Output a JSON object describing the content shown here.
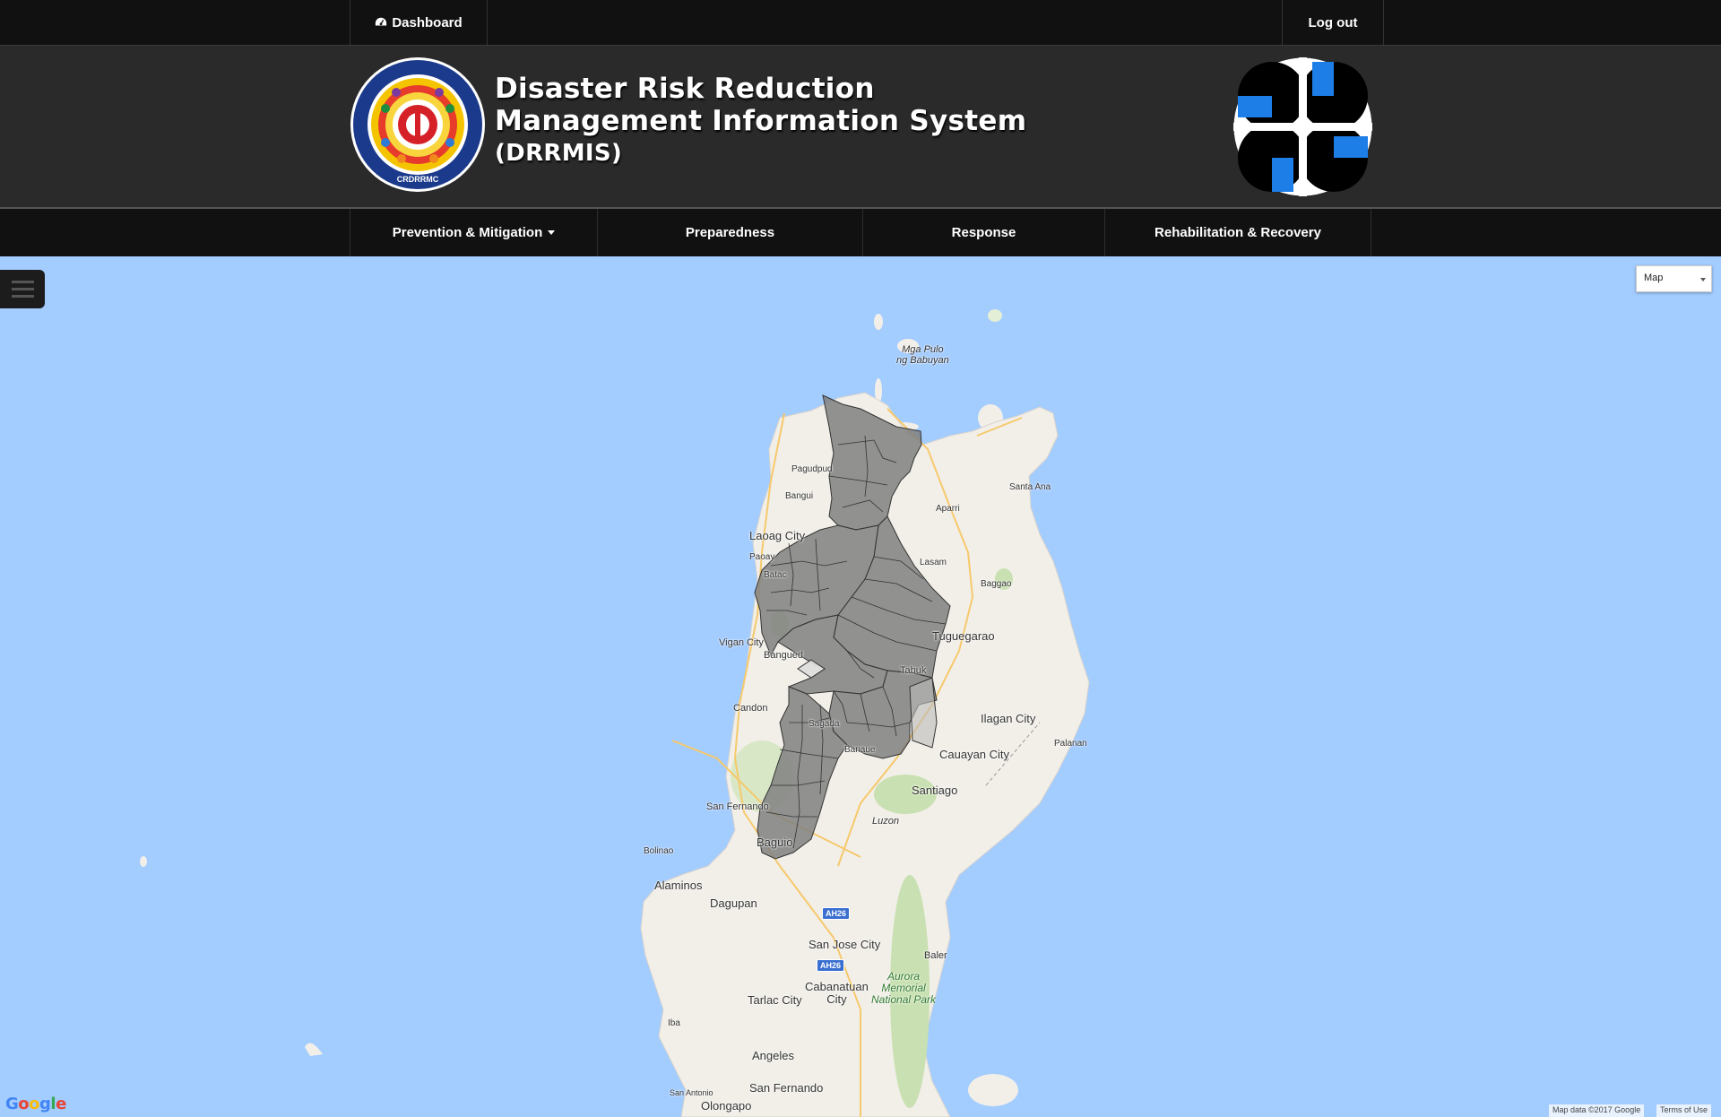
{
  "topbar": {
    "dashboard_label": "Dashboard",
    "logout_label": "Log out"
  },
  "header": {
    "title_line1": "Disaster Risk Reduction",
    "title_line2": "Management Information System",
    "title_line3": "(DRRMIS)",
    "seal_text": "CRDRRMC",
    "seal_ring_text": "CORDILLERA REGIONAL DISASTER RISK REDUCTION AND MANAGEMENT COUNCIL"
  },
  "mainnav": {
    "items": [
      {
        "label": "Prevention & Mitigation",
        "has_dropdown": true
      },
      {
        "label": "Preparedness",
        "has_dropdown": false
      },
      {
        "label": "Response",
        "has_dropdown": false
      },
      {
        "label": "Rehabilitation & Recovery",
        "has_dropdown": false
      }
    ]
  },
  "map": {
    "type_select": "Map",
    "google_logo": "Google",
    "attribution": "Map data ©2017 Google",
    "terms": "Terms of Use",
    "labels": {
      "mga_pulo": "Mga Pulo\nng Babuyan",
      "pagudpud": "Pagudpud",
      "bangui": "Bangui",
      "santa_ana": "Santa Ana",
      "aparri": "Aparri",
      "laoag": "Laoag City",
      "paoay": "Paoay",
      "batac": "Batac",
      "lasam": "Lasam",
      "baggao": "Baggao",
      "tuguegarao": "Tuguegarao",
      "vigan": "Vigan City",
      "bangued": "Bangued",
      "tabuk": "Tabuk",
      "candon": "Candon",
      "ilagan": "Ilagan City",
      "sagada": "Sagada",
      "palanan": "Palanan",
      "banaue": "Banaue",
      "cauayan": "Cauayan City",
      "santiago": "Santiago",
      "san_fernando_lu": "San Fernando",
      "luzon": "Luzon",
      "baguio": "Baguio",
      "bolinao": "Bolinao",
      "alaminos": "Alaminos",
      "dagupan": "Dagupan",
      "san_jose": "San Jose City",
      "baler": "Baler",
      "cabanatuan": "Cabanatuan\nCity",
      "aurora": "Aurora\nMemorial\nNational Park",
      "tarlac": "Tarlac City",
      "iba": "Iba",
      "angeles": "Angeles",
      "san_fernando_pa": "San Fernando",
      "san_antonio": "San Antonio",
      "olongapo": "Olongapo"
    },
    "road_badges": [
      "AH26",
      "AH26"
    ],
    "colors": {
      "water": "#a3ccff",
      "land": "#f2efe9",
      "region_fill": "#808080",
      "region_stroke": "#333333"
    }
  }
}
